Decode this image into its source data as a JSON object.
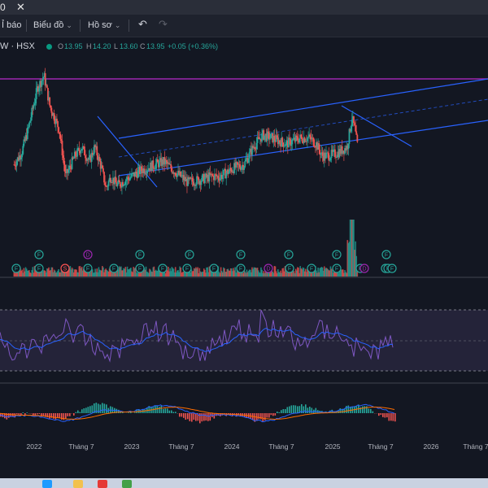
{
  "tab": {
    "title": "0",
    "close_icon": "close-icon"
  },
  "toolbar": {
    "indicators_label": "Ỉ báo",
    "chart_label": "Biểu đồ",
    "profile_label": "Hồ sơ",
    "undo_icon": "undo-icon",
    "redo_icon": "redo-icon",
    "chevron_icon": "chevron-down-icon"
  },
  "legend": {
    "symbol": "W · HSX",
    "open_label": "O",
    "open_value": "13.95",
    "high_label": "H",
    "high_value": "14.20",
    "low_label": "L",
    "low_value": "13.60",
    "close_label": "C",
    "close_value": "13.95",
    "change": "+0.05 (+0.36%)"
  },
  "colors": {
    "background": "#131722",
    "up": "#26a69a",
    "down": "#ef5350",
    "trendline": "#2962ff",
    "resistance": "#9c27b0",
    "rsi": "#7e57c2",
    "rsi_ma": "#2962ff",
    "macd": "#2962ff",
    "signal": "#ff6d00",
    "dividend_marker": "#9c27b0",
    "earnings_marker": "#26a69a",
    "split_marker": "#ff5252"
  },
  "time_axis": [
    "2022",
    "Tháng 7",
    "2023",
    "Tháng 7",
    "2024",
    "Tháng 7",
    "2025",
    "Tháng 7",
    "2026",
    "Tháng 7"
  ],
  "event_markers": {
    "row1": [
      "F",
      "D",
      "F",
      "F",
      "F",
      "F",
      "F",
      "F"
    ],
    "row2": [
      "F",
      "F",
      "S",
      "F",
      "F",
      "F",
      "F",
      "F",
      "F",
      "F",
      "D",
      "F",
      "F",
      "F",
      "F",
      "F",
      "D",
      "F",
      "F"
    ]
  },
  "chart_data": {
    "type": "line",
    "title": "",
    "symbol": "W · HSX",
    "price_series": [
      [
        2021.9,
        13.0
      ],
      [
        2021.98,
        13.4
      ],
      [
        2022.05,
        14.2
      ],
      [
        2022.15,
        15.6
      ],
      [
        2022.22,
        16.0
      ],
      [
        2022.28,
        15.0
      ],
      [
        2022.38,
        14.2
      ],
      [
        2022.45,
        12.6
      ],
      [
        2022.55,
        13.3
      ],
      [
        2022.62,
        13.6
      ],
      [
        2022.7,
        13.1
      ],
      [
        2022.76,
        13.6
      ],
      [
        2022.83,
        12.9
      ],
      [
        2022.88,
        12.2
      ],
      [
        2022.93,
        12.6
      ],
      [
        2023.0,
        12.3
      ],
      [
        2023.1,
        12.5
      ],
      [
        2023.25,
        12.8
      ],
      [
        2023.4,
        13.0
      ],
      [
        2023.5,
        13.1
      ],
      [
        2023.6,
        12.8
      ],
      [
        2023.75,
        12.4
      ],
      [
        2023.9,
        12.5
      ],
      [
        2024.0,
        12.6
      ],
      [
        2024.1,
        12.6
      ],
      [
        2024.25,
        12.9
      ],
      [
        2024.35,
        13.0
      ],
      [
        2024.45,
        13.6
      ],
      [
        2024.55,
        14.0
      ],
      [
        2024.65,
        13.9
      ],
      [
        2024.8,
        13.7
      ],
      [
        2024.95,
        13.9
      ],
      [
        2025.05,
        13.9
      ],
      [
        2025.12,
        13.7
      ],
      [
        2025.18,
        13.3
      ],
      [
        2025.25,
        13.3
      ],
      [
        2025.35,
        13.4
      ],
      [
        2025.45,
        13.6
      ],
      [
        2025.5,
        14.6
      ],
      [
        2025.53,
        14.2
      ],
      [
        2025.56,
        13.6
      ]
    ],
    "resistance_level": 15.4,
    "volume_spike_at": 2025.5
  }
}
